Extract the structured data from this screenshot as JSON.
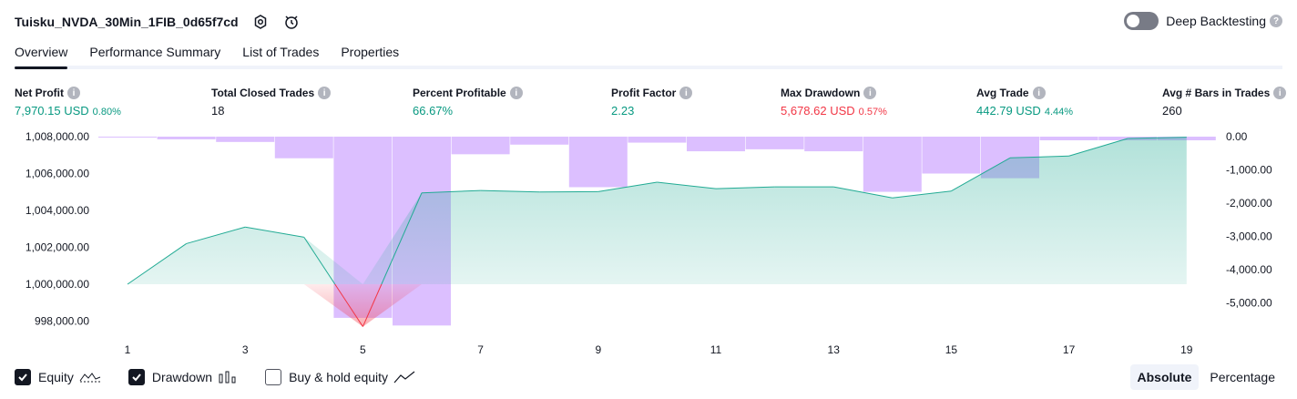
{
  "strategy": {
    "name": "Tuisku_NVDA_30Min_1FIB_0d65f7cd"
  },
  "deep_backtesting": {
    "label": "Deep Backtesting",
    "enabled": false
  },
  "tabs": [
    {
      "label": "Overview",
      "active": true
    },
    {
      "label": "Performance Summary",
      "active": false
    },
    {
      "label": "List of Trades",
      "active": false
    },
    {
      "label": "Properties",
      "active": false
    }
  ],
  "metrics": {
    "net_profit": {
      "label": "Net Profit",
      "value": "7,970.15 USD",
      "pct": "0.80%"
    },
    "total_closed_trades": {
      "label": "Total Closed Trades",
      "value": "18"
    },
    "percent_profitable": {
      "label": "Percent Profitable",
      "value": "66.67%"
    },
    "profit_factor": {
      "label": "Profit Factor",
      "value": "2.23"
    },
    "max_drawdown": {
      "label": "Max Drawdown",
      "value": "5,678.62 USD",
      "pct": "0.57%"
    },
    "avg_trade": {
      "label": "Avg Trade",
      "value": "442.79 USD",
      "pct": "4.44%"
    },
    "avg_bars": {
      "label": "Avg # Bars in Trades",
      "value": "260"
    }
  },
  "chart_data": {
    "type": "line",
    "x": [
      1,
      2,
      3,
      4,
      5,
      6,
      7,
      8,
      9,
      10,
      11,
      12,
      13,
      14,
      15,
      16,
      17,
      18,
      19
    ],
    "x_tick_labels": [
      "1",
      "3",
      "5",
      "7",
      "9",
      "11",
      "13",
      "15",
      "17",
      "19"
    ],
    "series": [
      {
        "name": "Equity",
        "axis": "left",
        "values": [
          1000000,
          1002200,
          1003100,
          1002550,
          997700,
          1004950,
          1005080,
          1005000,
          1005020,
          1005530,
          1005180,
          1005280,
          1005280,
          1004680,
          1005050,
          1006850,
          1006950,
          1007900,
          1007970
        ]
      },
      {
        "name": "Drawdown",
        "axis": "right",
        "type": "bar",
        "values": [
          0,
          -80,
          -160,
          -650,
          -5450,
          -5680,
          -530,
          -240,
          -1520,
          -180,
          -440,
          -380,
          -440,
          -1660,
          -1110,
          -1250,
          -110,
          -110,
          -110
        ]
      }
    ],
    "left_axis": {
      "ylim": [
        997000,
        1008200
      ],
      "ticks": [
        "1,008,000.00",
        "1,006,000.00",
        "1,004,000.00",
        "1,002,000.00",
        "1,000,000.00",
        "998,000.00"
      ],
      "tick_values": [
        1008000,
        1006000,
        1004000,
        1002000,
        1000000,
        998000
      ]
    },
    "right_axis": {
      "ylim": [
        -5900,
        0
      ],
      "ticks": [
        "0.00",
        "-1,000.00",
        "-2,000.00",
        "-3,000.00",
        "-4,000.00",
        "-5,000.00"
      ],
      "tick_values": [
        0,
        -1000,
        -2000,
        -3000,
        -4000,
        -5000
      ]
    },
    "colors": {
      "equity_line": "#22ab94",
      "equity_fill": "#22ab94",
      "below_fill": "#f23645",
      "drawdown_bar": "#d6b4ff"
    }
  },
  "legend": {
    "equity": {
      "label": "Equity",
      "checked": true
    },
    "drawdown": {
      "label": "Drawdown",
      "checked": true
    },
    "buy_hold": {
      "label": "Buy & hold equity",
      "checked": false
    }
  },
  "view_mode": {
    "absolute_label": "Absolute",
    "percentage_label": "Percentage",
    "selected": "Absolute"
  }
}
